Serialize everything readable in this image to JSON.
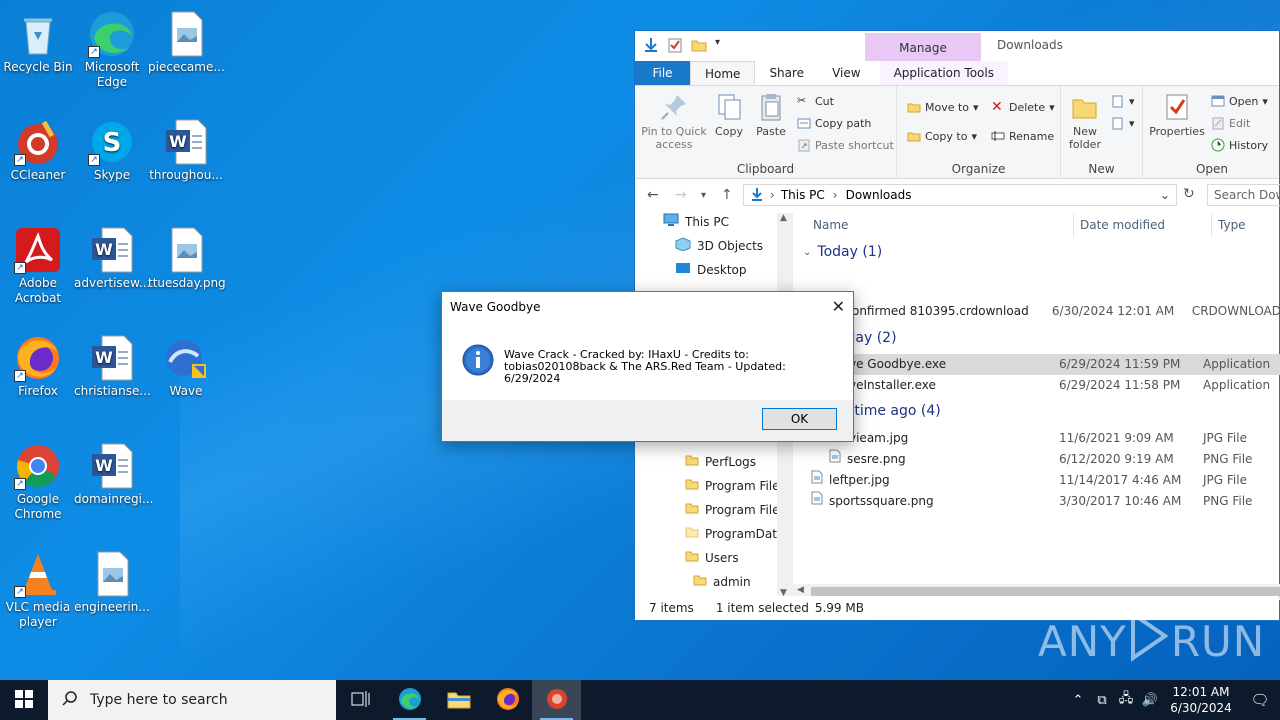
{
  "desktop": {
    "icons": [
      {
        "label": "Recycle Bin",
        "icon": "recycle-bin-icon"
      },
      {
        "label": "Microsoft Edge",
        "icon": "edge-icon"
      },
      {
        "label": "piececame...",
        "icon": "image-file-icon"
      },
      {
        "label": "CCleaner",
        "icon": "ccleaner-icon"
      },
      {
        "label": "Skype",
        "icon": "skype-icon"
      },
      {
        "label": "throughou...",
        "icon": "word-doc-icon"
      },
      {
        "label": "Adobe Acrobat",
        "icon": "acrobat-icon"
      },
      {
        "label": "advertisew...",
        "icon": "word-doc-icon"
      },
      {
        "label": "ttuesday.png",
        "icon": "image-file-icon"
      },
      {
        "label": "Firefox",
        "icon": "firefox-icon"
      },
      {
        "label": "christianse...",
        "icon": "word-doc-icon"
      },
      {
        "label": "Wave",
        "icon": "wave-icon"
      },
      {
        "label": "Google Chrome",
        "icon": "chrome-icon"
      },
      {
        "label": "domainregi...",
        "icon": "word-doc-icon"
      },
      {
        "label": "VLC media player",
        "icon": "vlc-icon"
      },
      {
        "label": "engineerin...",
        "icon": "image-file-icon"
      }
    ]
  },
  "explorer": {
    "title": "Downloads",
    "manage_tab": "Manage",
    "tabs": [
      "File",
      "Home",
      "Share",
      "View",
      "Application Tools"
    ],
    "ribbon": {
      "clipboard": {
        "label": "Clipboard",
        "pin": "Pin to Quick access",
        "copy": "Copy",
        "paste": "Paste",
        "cut": "Cut",
        "copy_path": "Copy path",
        "paste_shortcut": "Paste shortcut"
      },
      "organize": {
        "label": "Organize",
        "move_to": "Move to",
        "copy_to": "Copy to",
        "delete": "Delete",
        "rename": "Rename"
      },
      "new": {
        "label": "New",
        "new_folder": "New folder"
      },
      "open": {
        "label": "Open",
        "properties": "Properties",
        "open": "Open",
        "edit": "Edit",
        "history": "History"
      }
    },
    "address": {
      "parts": [
        "This PC",
        "Downloads"
      ],
      "search_placeholder": "Search Downl"
    },
    "nav": {
      "items": [
        "This PC",
        "3D Objects",
        "Desktop",
        "PerfLogs",
        "Program Files",
        "Program Files",
        "ProgramData",
        "Users",
        "admin"
      ]
    },
    "columns": {
      "name": "Name",
      "date": "Date modified",
      "type": "Type"
    },
    "groups": [
      {
        "title": "Today (1)",
        "files": [
          {
            "name": "Unconfirmed 810395.crdownload",
            "date": "6/30/2024 12:01 AM",
            "type": "CRDOWNLOAD"
          }
        ]
      },
      {
        "title": "rday (2)",
        "files": [
          {
            "name": "ve Goodbye.exe",
            "date": "6/29/2024 11:59 PM",
            "type": "Application"
          },
          {
            "name": "veInstaller.exe",
            "date": "6/29/2024 11:58 PM",
            "type": "Application"
          }
        ]
      },
      {
        "title": "g time ago (4)",
        "files": [
          {
            "name": "vieam.jpg",
            "date": "11/6/2021 9:09 AM",
            "type": "JPG File"
          },
          {
            "name": "sesre.png",
            "date": "6/12/2020 9:19 AM",
            "type": "PNG File"
          },
          {
            "name": "leftper.jpg",
            "date": "11/14/2017 4:46 AM",
            "type": "JPG File"
          },
          {
            "name": "sportssquare.png",
            "date": "3/30/2017 10:46 AM",
            "type": "PNG File"
          }
        ]
      }
    ],
    "status": {
      "items": "7 items",
      "selected": "1 item selected",
      "size": "5.99 MB"
    }
  },
  "dialog": {
    "title": "Wave Goodbye",
    "message": "Wave Crack - Cracked by: IHaxU - Credits to: tobias020108back & The ARS.Red Team - Updated: 6/29/2024",
    "ok": "OK"
  },
  "taskbar": {
    "search_placeholder": "Type here to search",
    "time": "12:01 AM",
    "date": "6/30/2024"
  },
  "watermark": {
    "left": "ANY",
    "right": "RUN"
  }
}
